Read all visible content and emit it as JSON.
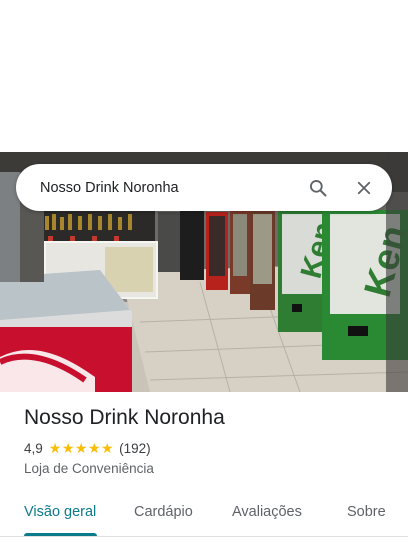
{
  "search": {
    "query": "Nosso Drink Noronha",
    "search_icon": "search-icon",
    "clear_icon": "close-icon"
  },
  "photo": {
    "fridge_brand_text": "Ken"
  },
  "place": {
    "name": "Nosso Drink Noronha",
    "rating": "4,9",
    "stars": 5,
    "review_count": "(192)",
    "category": "Loja de Conveniência"
  },
  "tabs": [
    {
      "label": "Visão geral",
      "active": true
    },
    {
      "label": "Cardápio",
      "active": false
    },
    {
      "label": "Avaliações",
      "active": false
    },
    {
      "label": "Sobre",
      "active": false
    }
  ],
  "colors": {
    "accent": "#0b7a8a",
    "star": "#fbbc04"
  }
}
